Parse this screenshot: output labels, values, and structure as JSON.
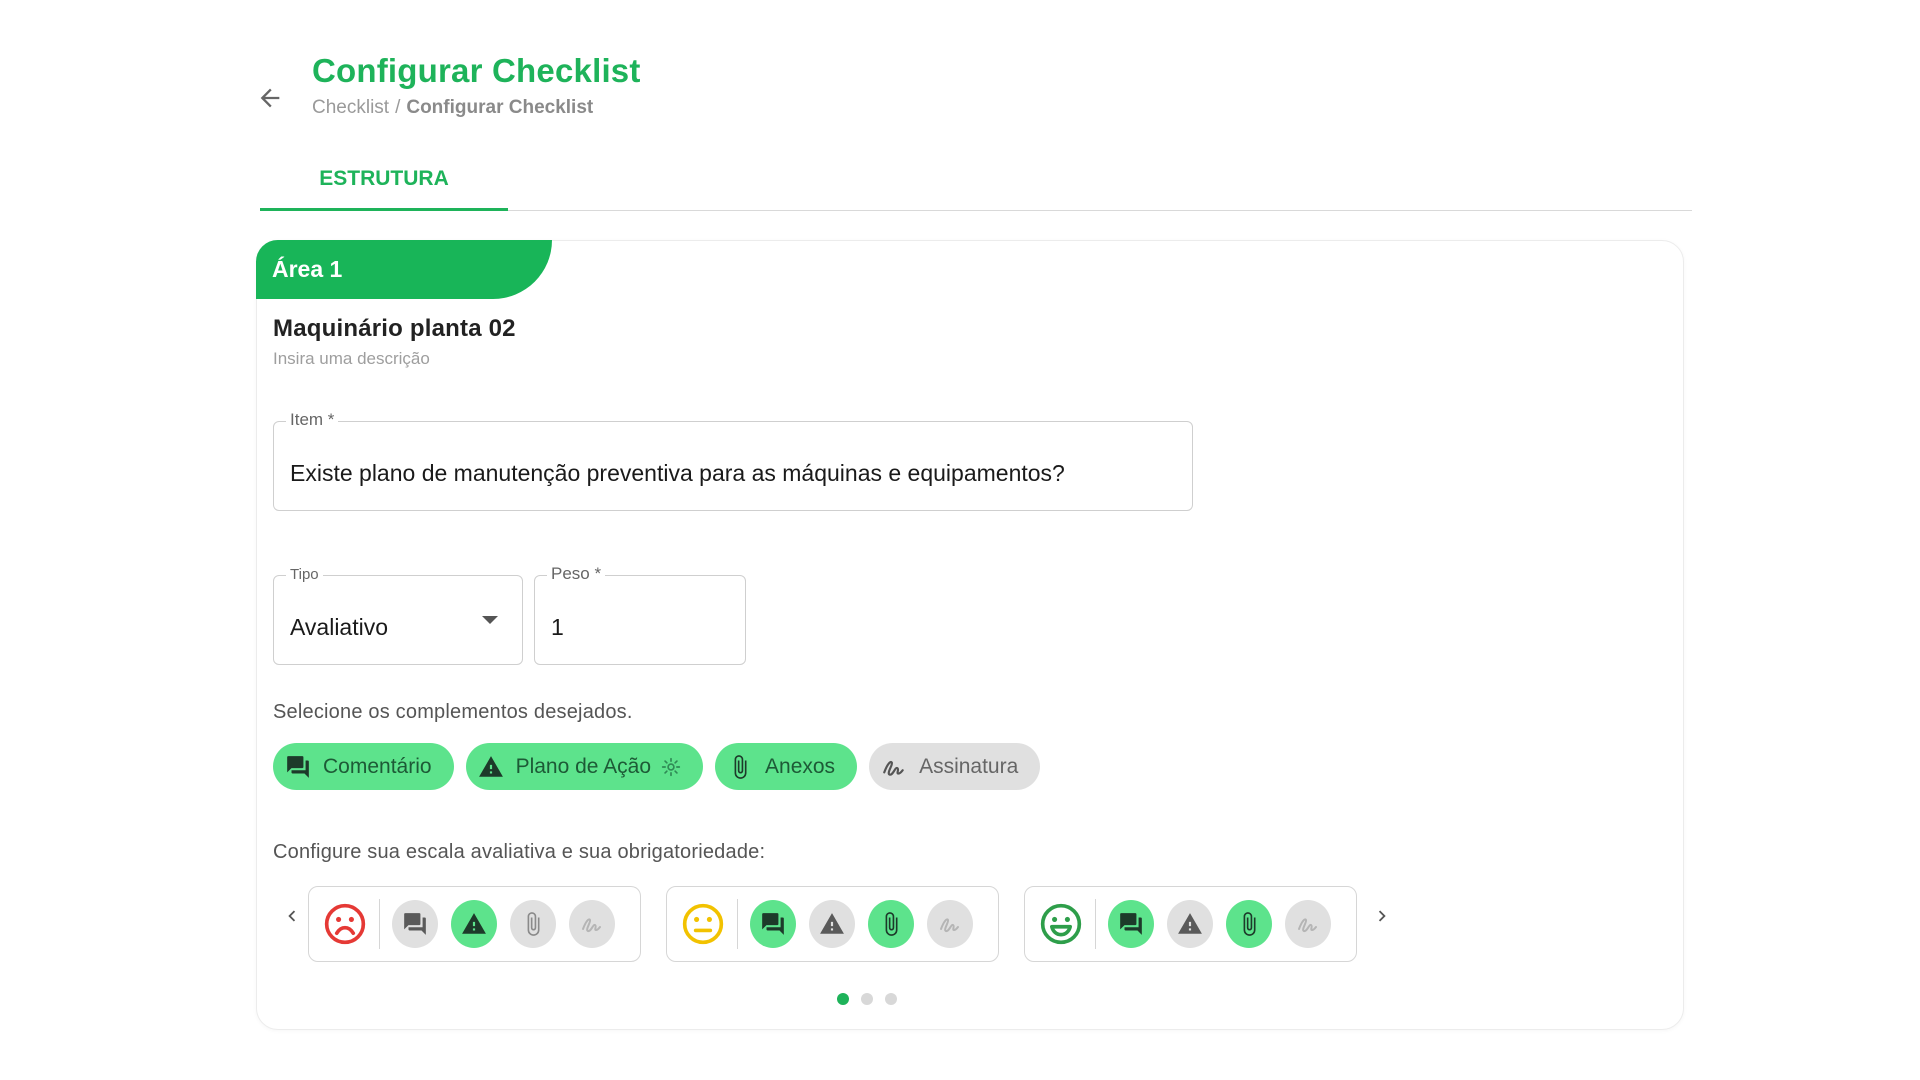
{
  "header": {
    "title": "Configurar Checklist",
    "breadcrumb": {
      "root": "Checklist",
      "separator": "/",
      "current": "Configurar Checklist"
    }
  },
  "tabs": [
    {
      "label": "ESTRUTURA",
      "active": true
    }
  ],
  "area": {
    "badge": "Área 1",
    "name": "Maquinário planta 02",
    "description_placeholder": "Insira uma descrição"
  },
  "item": {
    "label": "Item *",
    "value": "Existe plano de manutenção preventiva para as máquinas e equipamentos?"
  },
  "tipo": {
    "label": "Tipo",
    "value": "Avaliativo"
  },
  "peso": {
    "label": "Peso *",
    "value": "1"
  },
  "complements": {
    "hint": "Selecione os complementos desejados.",
    "chips": [
      {
        "label": "Comentário",
        "icon": "comment-icon",
        "selected": true
      },
      {
        "label": "Plano de Ação",
        "icon": "warning-icon",
        "selected": true,
        "settings_icon": "gear-icon"
      },
      {
        "label": "Anexos",
        "icon": "paperclip-icon",
        "selected": true
      },
      {
        "label": "Assinatura",
        "icon": "signature-icon",
        "selected": false
      }
    ]
  },
  "scale": {
    "hint": "Configure sua escala avaliativa e sua obrigatoriedade:",
    "levels": [
      {
        "face": "sad-face-icon",
        "face_color": "#e53935",
        "comentario": false,
        "plano": true,
        "anexos": false,
        "assinatura": false
      },
      {
        "face": "neutral-face-icon",
        "face_color": "#f2c200",
        "comentario": true,
        "plano": false,
        "anexos": true,
        "assinatura": false
      },
      {
        "face": "happy-face-icon",
        "face_color": "#2e9e4a",
        "comentario": true,
        "plano": false,
        "anexos": true,
        "assinatura": false
      }
    ],
    "pagination": {
      "pages": 3,
      "active": 1
    }
  },
  "colors": {
    "accent": "#1eb35a",
    "chip_on": "#5de38c",
    "chip_off": "#e0e0e0"
  }
}
